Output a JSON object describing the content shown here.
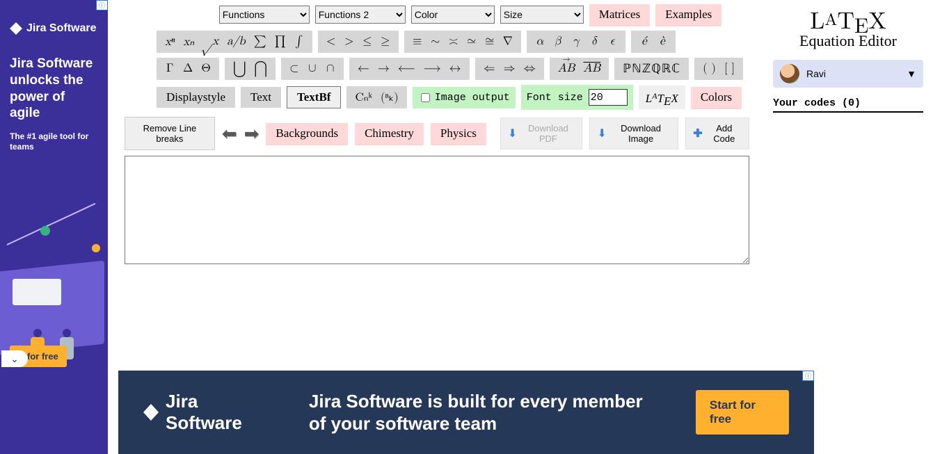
{
  "left_ad": {
    "badge": "ⓘ",
    "brand": "Jira Software",
    "headline": "Jira Software unlocks the power of agile",
    "sub": "The #1 agile tool for teams",
    "cta": "rt for free",
    "chevron": "⌄"
  },
  "top_selects": {
    "functions": "Functions",
    "functions2": "Functions 2",
    "color": "Color",
    "size": "Size"
  },
  "top_buttons": {
    "matrices": "Matrices",
    "examples": "Examples"
  },
  "sym_row1": {
    "g1": [
      "xⁿ",
      "xₙ",
      "√x",
      "a⁄b",
      "∑",
      "∏",
      "∫"
    ],
    "g2": [
      "<",
      ">",
      "≤",
      "≥"
    ],
    "g3": [
      "≡",
      "∼",
      "≍",
      "≃",
      "≅",
      "∇"
    ],
    "g4": [
      "α",
      "β",
      "γ",
      "δ",
      "ϵ"
    ],
    "g5": [
      "é",
      "è"
    ]
  },
  "sym_row2": {
    "g1": [
      "Γ",
      "Δ",
      "Θ"
    ],
    "g2": [
      "⋃",
      "⋂"
    ],
    "g3": [
      "⊂",
      "∪",
      "∩"
    ],
    "g4": [
      "←",
      "→",
      "⟵",
      "⟶",
      "↔"
    ],
    "g5": [
      "⇐",
      "⇒",
      "⇔"
    ],
    "g6_vec": "AB",
    "g6_bar": "AB",
    "g7": "ℙℕℤℚℝℂ",
    "g8": [
      "( )",
      "[ ]"
    ]
  },
  "row3": {
    "displaystyle": "Displaystyle",
    "text": "Text",
    "textbf": "TextBf",
    "cnk": "Cₙᵏ",
    "binom": "(ⁿₖ)",
    "image_output": "Image output",
    "font_size_label": "Font size",
    "font_size": "20",
    "latex": "LᴬTᴇX",
    "colors": "Colors"
  },
  "actions": {
    "remove_line_breaks": "Remove Line breaks",
    "prev": "⬅",
    "next": "➡",
    "backgrounds": "Backgrounds",
    "chimestry": "Chimestry",
    "physics": "Physics",
    "download_pdf": "Download PDF",
    "download_image": "Download Image",
    "add_code": "Add Code"
  },
  "textarea_value": "",
  "right": {
    "logo_main": "LᴬTᴇX",
    "logo_sub": "Equation Editor",
    "username": "Ravi",
    "chevron": "▼",
    "codes_header": "Your codes (0)"
  },
  "bottom_ad": {
    "badge": "ⓘ",
    "brand": "Jira Software",
    "headline": "Jira Software is built for every member of your software team",
    "cta": "Start for free"
  }
}
